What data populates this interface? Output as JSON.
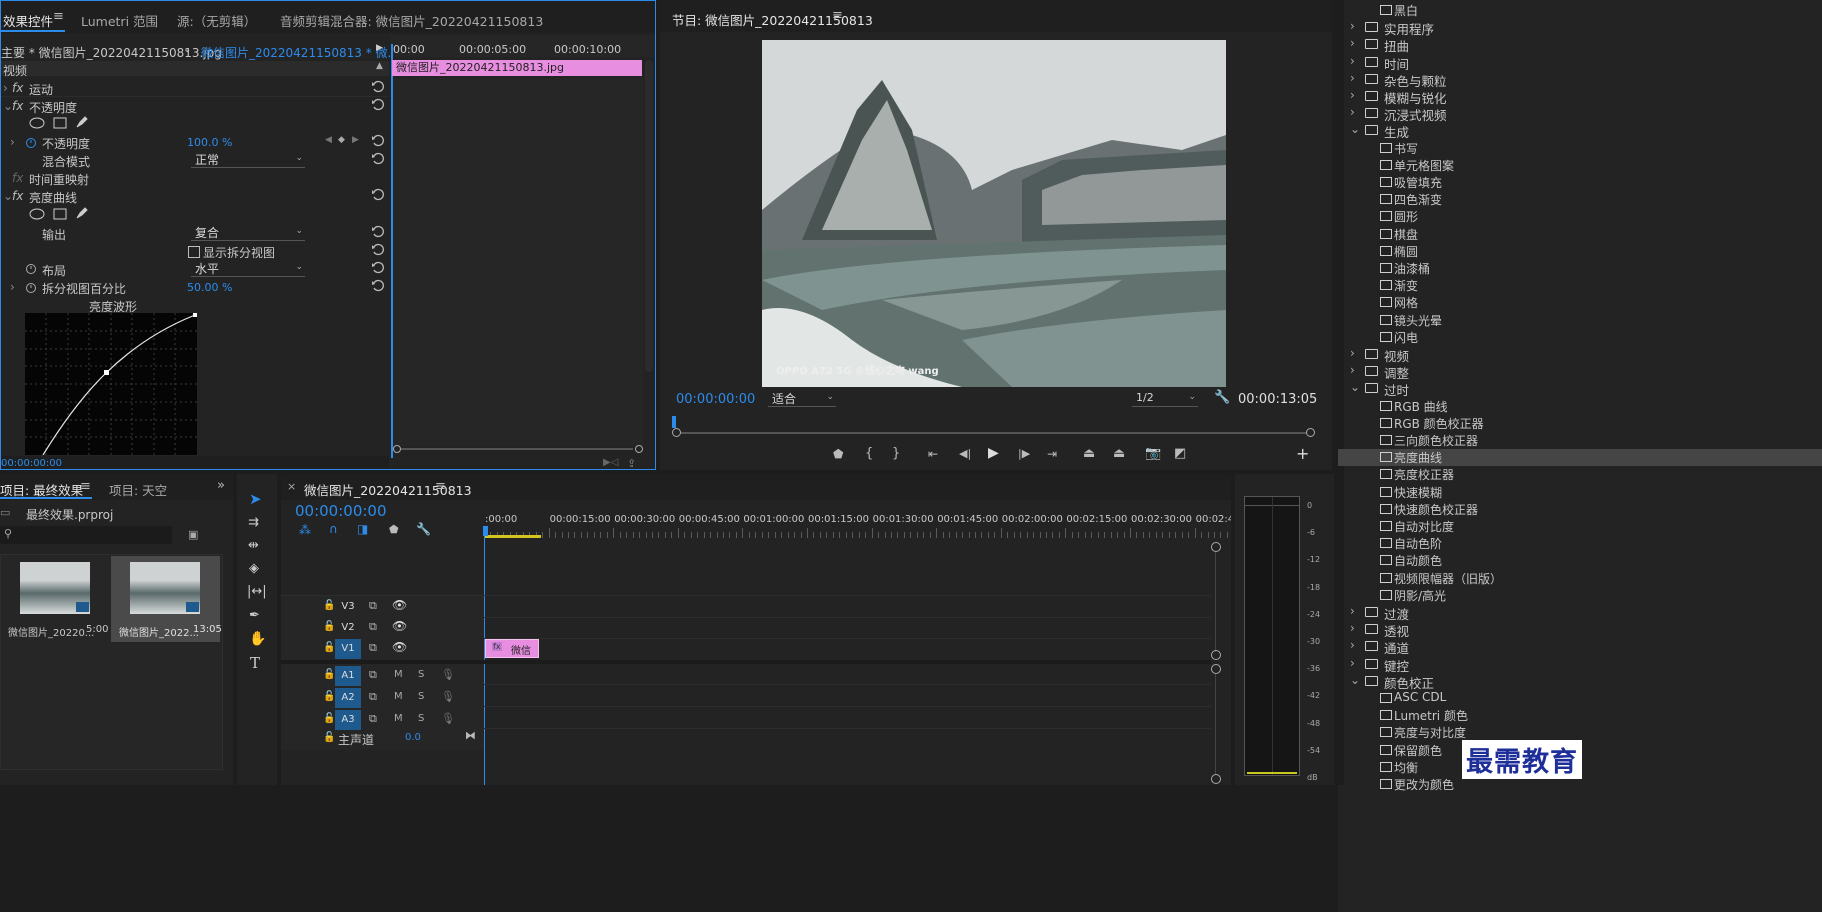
{
  "effect_controls": {
    "tabs": [
      "效果控件",
      "Lumetri 范围",
      "源:（无剪辑）",
      "音频剪辑混合器: 微信图片_20220421150813"
    ],
    "master_label": "主要 * 微信图片_20220421150813.jpg",
    "clip_label": "微信图片_20220421150813 * 微...",
    "timecodes": [
      "00:00",
      "00:00:05:00",
      "00:00:10:00"
    ],
    "clip_bar": "微信图片_20220421150813.jpg",
    "section_video": "视频",
    "motion": "运动",
    "opacity": "不透明度",
    "opacity_prop": "不透明度",
    "opacity_value": "100.0 %",
    "blend_mode_label": "混合模式",
    "blend_mode_value": "正常",
    "time_remap": "时间重映射",
    "brightness_curves": "亮度曲线",
    "output_label": "输出",
    "output_value": "复合",
    "split_view_label": "显示拆分视图",
    "layout_label": "布局",
    "layout_value": "水平",
    "split_pct_label": "拆分视图百分比",
    "split_pct_value": "50.00 %",
    "waveform_label": "亮度波形",
    "bottom_timecode": "00:00:00:00"
  },
  "program_monitor": {
    "title": "节目: 微信图片_20220421150813",
    "current_time": "00:00:00:00",
    "fit": "适合",
    "resolution": "1/2",
    "duration": "00:00:13:05",
    "watermark": "OPPO A72 5G  ©钱心之吻 wang"
  },
  "project": {
    "tabs": [
      "项目: 最终效果",
      "项目: 天空"
    ],
    "file": "最终效果.prproj",
    "items": [
      {
        "name": "微信图片_20220...",
        "dur": "5:00"
      },
      {
        "name": "微信图片_2022...",
        "dur": "13:05"
      }
    ]
  },
  "timeline": {
    "tab": "微信图片_20220421150813",
    "current_time": "00:00:00:00",
    "ruler": [
      ":00:00",
      "00:00:15:00",
      "00:00:30:00",
      "00:00:45:00",
      "00:01:00:00",
      "00:01:15:00",
      "00:01:30:00",
      "00:01:45:00",
      "00:02:00:00",
      "00:02:15:00",
      "00:02:30:00",
      "00:02:45:"
    ],
    "video_tracks": [
      "V3",
      "V2",
      "V1"
    ],
    "audio_tracks": [
      "A1",
      "A2",
      "A3"
    ],
    "master": "主声道",
    "master_value": "0.0",
    "clip_name": "微信",
    "mute_label": "M",
    "solo_label": "S"
  },
  "meter": {
    "ticks": [
      "0",
      "-6",
      "-12",
      "-18",
      "-24",
      "-30",
      "-36",
      "-42",
      "-48",
      "-54",
      "dB"
    ]
  },
  "effects_panel": {
    "items": [
      {
        "type": "leaf",
        "label": "黑白"
      },
      {
        "type": "folder",
        "label": "实用程序"
      },
      {
        "type": "folder",
        "label": "扭曲"
      },
      {
        "type": "folder",
        "label": "时间"
      },
      {
        "type": "folder",
        "label": "杂色与颗粒"
      },
      {
        "type": "folder",
        "label": "模糊与锐化"
      },
      {
        "type": "folder",
        "label": "沉浸式视频"
      },
      {
        "type": "folder-open",
        "label": "生成"
      },
      {
        "type": "leaf",
        "label": "书写"
      },
      {
        "type": "leaf",
        "label": "单元格图案"
      },
      {
        "type": "leaf",
        "label": "吸管填充"
      },
      {
        "type": "leaf",
        "label": "四色渐变"
      },
      {
        "type": "leaf",
        "label": "圆形"
      },
      {
        "type": "leaf",
        "label": "棋盘"
      },
      {
        "type": "leaf",
        "label": "椭圆"
      },
      {
        "type": "leaf",
        "label": "油漆桶"
      },
      {
        "type": "leaf",
        "label": "渐变"
      },
      {
        "type": "leaf",
        "label": "网格"
      },
      {
        "type": "leaf",
        "label": "镜头光晕"
      },
      {
        "type": "leaf",
        "label": "闪电"
      },
      {
        "type": "folder",
        "label": "视频"
      },
      {
        "type": "folder",
        "label": "调整"
      },
      {
        "type": "folder-open",
        "label": "过时"
      },
      {
        "type": "leaf",
        "label": "RGB 曲线"
      },
      {
        "type": "leaf",
        "label": "RGB 颜色校正器"
      },
      {
        "type": "leaf",
        "label": "三向颜色校正器"
      },
      {
        "type": "leaf",
        "label": "亮度曲线",
        "selected": true
      },
      {
        "type": "leaf",
        "label": "亮度校正器"
      },
      {
        "type": "leaf",
        "label": "快速模糊"
      },
      {
        "type": "leaf",
        "label": "快速颜色校正器"
      },
      {
        "type": "leaf",
        "label": "自动对比度"
      },
      {
        "type": "leaf",
        "label": "自动色阶"
      },
      {
        "type": "leaf",
        "label": "自动颜色"
      },
      {
        "type": "leaf",
        "label": "视频限幅器（旧版）"
      },
      {
        "type": "leaf",
        "label": "阴影/高光"
      },
      {
        "type": "folder",
        "label": "过渡"
      },
      {
        "type": "folder",
        "label": "透视"
      },
      {
        "type": "folder",
        "label": "通道"
      },
      {
        "type": "folder",
        "label": "键控"
      },
      {
        "type": "folder-open",
        "label": "颜色校正"
      },
      {
        "type": "leaf",
        "label": "ASC CDL"
      },
      {
        "type": "leaf",
        "label": "Lumetri 颜色"
      },
      {
        "type": "leaf",
        "label": "亮度与对比度"
      },
      {
        "type": "leaf",
        "label": "保留颜色"
      },
      {
        "type": "leaf",
        "label": "均衡"
      },
      {
        "type": "leaf",
        "label": "更改为颜色"
      }
    ]
  },
  "watermark_brand": "最需教育",
  "colors": {
    "accent": "#2d8ceb",
    "clip_pink": "#e88ee0",
    "track_blue": "#1e5a8e"
  }
}
